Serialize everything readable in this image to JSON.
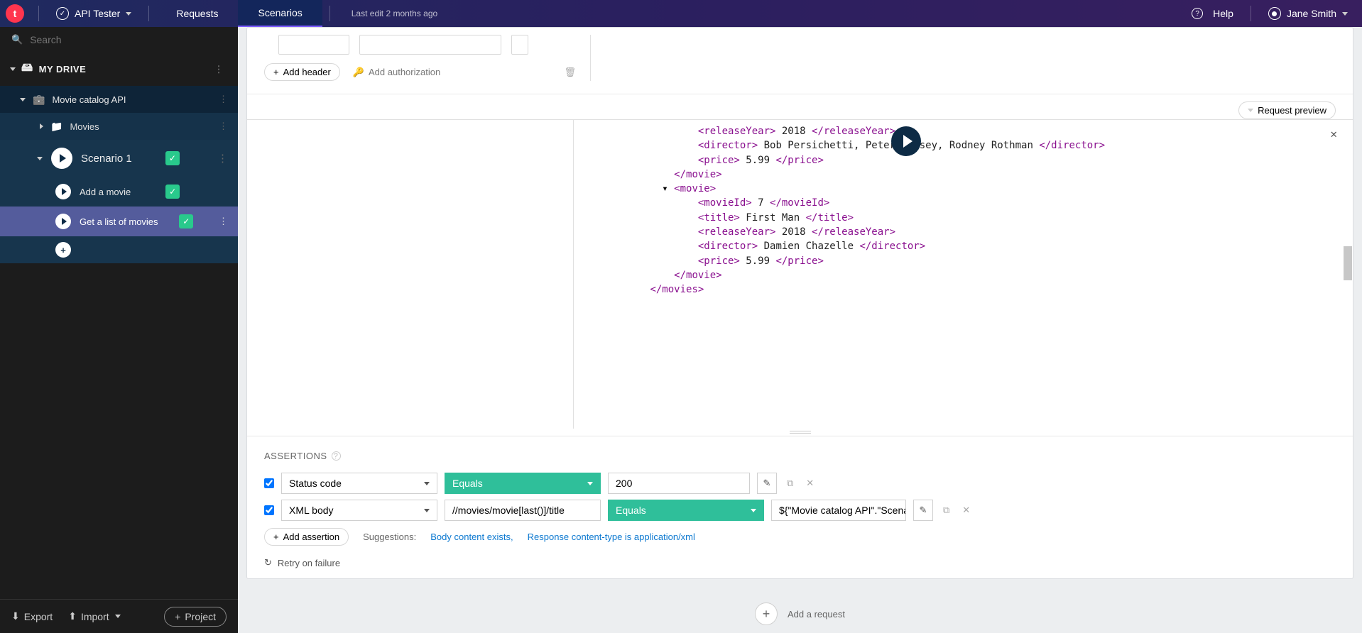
{
  "topbar": {
    "app_name": "API Tester",
    "nav": {
      "requests": "Requests",
      "scenarios": "Scenarios"
    },
    "last_edit": "Last edit 2 months ago",
    "help": "Help",
    "user_name": "Jane Smith"
  },
  "sidebar": {
    "search_placeholder": "Search",
    "drive_label": "MY DRIVE",
    "project": {
      "name": "Movie catalog API"
    },
    "folder": {
      "name": "Movies"
    },
    "scenario": {
      "name": "Scenario 1"
    },
    "steps": {
      "add_movie": "Add a movie",
      "get_list": "Get a list of movies"
    },
    "footer": {
      "export": "Export",
      "import": "Import",
      "project": "Project"
    }
  },
  "header": {
    "add_header": "Add header",
    "add_auth": "Add authorization",
    "request_preview": "Request preview"
  },
  "response": {
    "lines": [
      {
        "indent": 4,
        "tag_open": "<releaseYear>",
        "text": " 2018 ",
        "tag_close": "</releaseYear>"
      },
      {
        "indent": 4,
        "tag_open": "<director>",
        "text": " Bob Persichetti, Peter Ramsey, Rodney Rothman ",
        "tag_close": "</director>"
      },
      {
        "indent": 4,
        "tag_open": "<price>",
        "text": " 5.99 ",
        "tag_close": "</price>"
      },
      {
        "indent": 3,
        "tag_open": "</movie>",
        "text": "",
        "tag_close": ""
      },
      {
        "indent": 3,
        "caret": true,
        "tag_open": "<movie>",
        "text": "",
        "tag_close": ""
      },
      {
        "indent": 4,
        "tag_open": "<movieId>",
        "text": " 7 ",
        "tag_close": "</movieId>"
      },
      {
        "indent": 4,
        "tag_open": "<title>",
        "text": " First Man ",
        "tag_close": "</title>"
      },
      {
        "indent": 4,
        "tag_open": "<releaseYear>",
        "text": " 2018 ",
        "tag_close": "</releaseYear>"
      },
      {
        "indent": 4,
        "tag_open": "<director>",
        "text": " Damien Chazelle ",
        "tag_close": "</director>"
      },
      {
        "indent": 4,
        "tag_open": "<price>",
        "text": " 5.99 ",
        "tag_close": "</price>"
      },
      {
        "indent": 3,
        "tag_open": "</movie>",
        "text": "",
        "tag_close": ""
      },
      {
        "indent": 2,
        "tag_open": "</movies>",
        "text": "",
        "tag_close": ""
      }
    ]
  },
  "assertions": {
    "title": "ASSERTIONS",
    "row1": {
      "source": "Status code",
      "op": "Equals",
      "value": "200"
    },
    "row2": {
      "source": "XML body",
      "path": "//movies/movie[last()]/title",
      "op": "Equals",
      "value": "${\"Movie catalog API\".\"Scena"
    },
    "add_assertion": "Add assertion",
    "suggestions_label": "Suggestions:",
    "sugg1": "Body content exists,",
    "sugg2": "Response content-type is application/xml",
    "retry": "Retry on failure"
  },
  "add_request": {
    "label": "Add a request"
  }
}
